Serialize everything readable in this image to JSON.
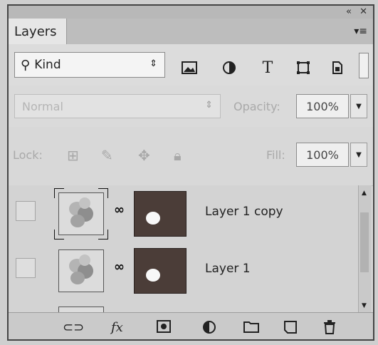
{
  "panel": {
    "collapse_icon": "double-chevron-icon",
    "close_icon": "close-icon",
    "tab_title": "Layers",
    "menu_icon": "panel-menu-icon"
  },
  "filter": {
    "kind_label": "Kind",
    "filter_icons": [
      "pixel-filter-icon",
      "adjustment-filter-icon",
      "type-filter-icon",
      "shape-filter-icon",
      "smart-object-filter-icon"
    ]
  },
  "blend": {
    "mode": "Normal",
    "opacity_label": "Opacity:",
    "opacity_value": "100%"
  },
  "lock": {
    "label": "Lock:",
    "fill_label": "Fill:",
    "fill_value": "100%"
  },
  "layers": [
    {
      "name": "Layer 1 copy",
      "selected": true
    },
    {
      "name": "Layer 1",
      "selected": false
    },
    {
      "name": "",
      "selected": false
    }
  ],
  "bottom_icons": [
    "link-layers-icon",
    "fx-icon",
    "add-mask-icon",
    "adjustment-layer-icon",
    "new-group-icon",
    "new-layer-icon",
    "delete-layer-icon"
  ],
  "colors": {
    "mask_background": "#4b3d38",
    "panel_background": "#d9d9d9"
  }
}
